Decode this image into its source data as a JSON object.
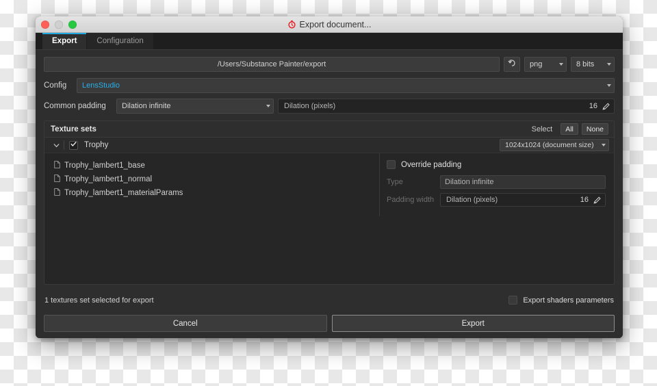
{
  "window": {
    "title": "Export document...",
    "app_icon": "substance-painter-icon",
    "traffic_lights": [
      "close",
      "minimize",
      "zoom"
    ]
  },
  "tabs": [
    {
      "label": "Export",
      "active": true
    },
    {
      "label": "Configuration",
      "active": false
    }
  ],
  "export_path": {
    "value": "/Users/Substance Painter/export",
    "reset_icon": "undo-arrow-icon",
    "format": "png",
    "bit_depth": "8 bits"
  },
  "config": {
    "label": "Config",
    "value": "LensStudio",
    "accent_color": "#29b0ea"
  },
  "common_padding": {
    "label": "Common padding",
    "type": "Dilation infinite",
    "dilation_label": "Dilation (pixels)",
    "dilation_value": "16",
    "edit_icon": "pencil-icon"
  },
  "texture_sets": {
    "title": "Texture sets",
    "select_label": "Select",
    "select_all": "All",
    "select_none": "None",
    "set": {
      "name": "Trophy",
      "checked": true,
      "expanded": true,
      "expand_icon": "chevron-down-icon",
      "check_icon": "checkmark-icon",
      "size": "1024x1024 (document size)"
    },
    "files": [
      {
        "name": "Trophy_lambert1_base",
        "icon": "document-icon"
      },
      {
        "name": "Trophy_lambert1_normal",
        "icon": "document-icon"
      },
      {
        "name": "Trophy_lambert1_materialParams",
        "icon": "document-icon"
      }
    ],
    "override": {
      "label": "Override padding",
      "checked": false,
      "type_label": "Type",
      "type_value": "Dilation infinite",
      "width_label": "Padding width",
      "width_field_label": "Dilation (pixels)",
      "width_value": "16",
      "edit_icon": "pencil-icon"
    }
  },
  "status": {
    "text": "1 textures set selected for export",
    "shader_checkbox_label": "Export shaders parameters",
    "shader_checkbox_checked": false
  },
  "buttons": {
    "cancel": "Cancel",
    "export": "Export"
  }
}
